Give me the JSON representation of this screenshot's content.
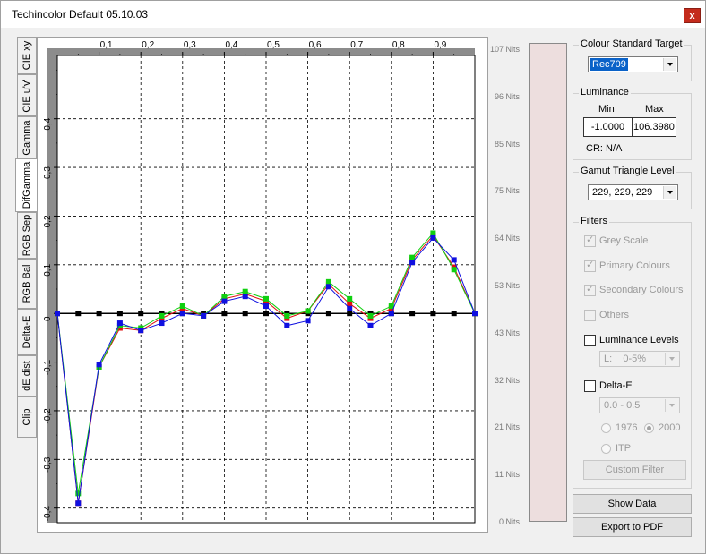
{
  "window": {
    "title": "Techincolor Default 05.10.03",
    "close_label": "x"
  },
  "tabs": [
    {
      "label": "CIE xy",
      "active": false
    },
    {
      "label": "CIE u'v'",
      "active": false
    },
    {
      "label": "Gamma",
      "active": false
    },
    {
      "label": "DifGamma",
      "active": true
    },
    {
      "label": "RGB Sep",
      "active": false
    },
    {
      "label": "RGB Bal",
      "active": false
    },
    {
      "label": "Delta-E",
      "active": false
    },
    {
      "label": "dE dist",
      "active": false
    },
    {
      "label": "Clip",
      "active": false
    }
  ],
  "chart_data": {
    "type": "line",
    "x_ticks": [
      "0,1",
      "0,2",
      "0,3",
      "0,4",
      "0,5",
      "0,6",
      "0,7",
      "0,8",
      "0,9"
    ],
    "y_ticks": [
      "0,4",
      "0,3",
      "0,2",
      "0,1",
      "0",
      "-0,1",
      "-0,2",
      "-0,3",
      "-0,4"
    ],
    "xlim": [
      0,
      1
    ],
    "ylim": [
      -0.43,
      0.53
    ],
    "grid": true,
    "x": [
      0,
      0.05,
      0.1,
      0.15,
      0.2,
      0.25,
      0.3,
      0.35,
      0.4,
      0.45,
      0.5,
      0.55,
      0.6,
      0.65,
      0.7,
      0.75,
      0.8,
      0.85,
      0.9,
      0.95,
      1.0
    ],
    "series": [
      {
        "color": "#000000",
        "values": [
          0,
          0,
          0,
          0,
          0,
          0,
          0,
          0,
          0,
          0,
          0,
          0,
          0,
          0,
          0,
          0,
          0,
          0,
          0,
          0,
          0
        ]
      },
      {
        "color": "#e01010",
        "values": [
          0,
          -0.39,
          -0.11,
          -0.03,
          -0.035,
          -0.01,
          0.01,
          -0.005,
          0.03,
          0.04,
          0.025,
          -0.01,
          0.005,
          0.06,
          0.02,
          -0.01,
          0.01,
          0.11,
          0.16,
          0.095,
          0
        ]
      },
      {
        "color": "#10d010",
        "values": [
          0,
          -0.37,
          -0.11,
          -0.025,
          -0.03,
          -0.005,
          0.015,
          -0.005,
          0.035,
          0.045,
          0.03,
          -0.005,
          0.005,
          0.065,
          0.03,
          -0.005,
          0.015,
          0.115,
          0.165,
          0.09,
          0
        ]
      },
      {
        "color": "#1010e0",
        "values": [
          0,
          -0.39,
          -0.105,
          -0.02,
          -0.035,
          -0.02,
          0.0,
          -0.005,
          0.025,
          0.035,
          0.015,
          -0.025,
          -0.015,
          0.055,
          0.01,
          -0.025,
          0.0,
          0.105,
          0.155,
          0.11,
          0
        ]
      }
    ]
  },
  "luminance_scale": {
    "ticks": [
      "107 Nits",
      "96 Nits",
      "85 Nits",
      "75 Nits",
      "64 Nits",
      "53 Nits",
      "43 Nits",
      "32 Nits",
      "21 Nits",
      "11 Nits",
      "0 Nits"
    ]
  },
  "colour_standard": {
    "label": "Colour Standard Target",
    "value": "Rec709"
  },
  "luminance": {
    "label": "Luminance",
    "min_label": "Min",
    "max_label": "Max",
    "min_value": "-1.0000",
    "max_value": "106.3980",
    "cr_text": "CR: N/A"
  },
  "gamut": {
    "label": "Gamut Triangle Level",
    "value": "229, 229, 229"
  },
  "filters": {
    "label": "Filters",
    "grey_scale": {
      "label": "Grey Scale",
      "checked": true,
      "enabled": false
    },
    "primary_colours": {
      "label": "Primary Colours",
      "checked": true,
      "enabled": false
    },
    "secondary_colours": {
      "label": "Secondary Colours",
      "checked": true,
      "enabled": false
    },
    "others": {
      "label": "Others",
      "checked": false,
      "enabled": false
    },
    "luminance_levels": {
      "label": "Luminance Levels",
      "checked": false,
      "enabled": true
    },
    "luminance_select": "L:    0-5%",
    "delta_e": {
      "label": "Delta-E",
      "checked": false,
      "enabled": true
    },
    "delta_e_select": "0.0 - 0.5",
    "radio_1976": "1976",
    "radio_2000": "2000",
    "radio_itp": "ITP",
    "custom_filter": "Custom Filter"
  },
  "buttons": {
    "show_data": "Show Data",
    "export_pdf": "Export to PDF"
  }
}
